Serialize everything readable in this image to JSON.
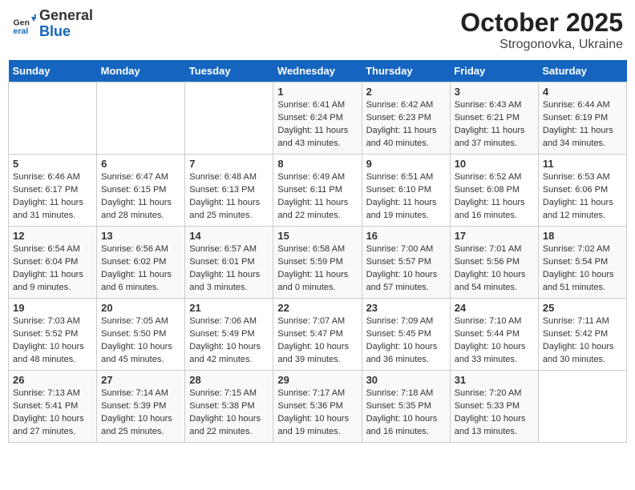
{
  "header": {
    "logo_general": "General",
    "logo_blue": "Blue",
    "month_title": "October 2025",
    "subtitle": "Strogonovka, Ukraine"
  },
  "weekdays": [
    "Sunday",
    "Monday",
    "Tuesday",
    "Wednesday",
    "Thursday",
    "Friday",
    "Saturday"
  ],
  "weeks": [
    [
      {
        "day": "",
        "info": ""
      },
      {
        "day": "",
        "info": ""
      },
      {
        "day": "",
        "info": ""
      },
      {
        "day": "1",
        "info": "Sunrise: 6:41 AM\nSunset: 6:24 PM\nDaylight: 11 hours\nand 43 minutes."
      },
      {
        "day": "2",
        "info": "Sunrise: 6:42 AM\nSunset: 6:23 PM\nDaylight: 11 hours\nand 40 minutes."
      },
      {
        "day": "3",
        "info": "Sunrise: 6:43 AM\nSunset: 6:21 PM\nDaylight: 11 hours\nand 37 minutes."
      },
      {
        "day": "4",
        "info": "Sunrise: 6:44 AM\nSunset: 6:19 PM\nDaylight: 11 hours\nand 34 minutes."
      }
    ],
    [
      {
        "day": "5",
        "info": "Sunrise: 6:46 AM\nSunset: 6:17 PM\nDaylight: 11 hours\nand 31 minutes."
      },
      {
        "day": "6",
        "info": "Sunrise: 6:47 AM\nSunset: 6:15 PM\nDaylight: 11 hours\nand 28 minutes."
      },
      {
        "day": "7",
        "info": "Sunrise: 6:48 AM\nSunset: 6:13 PM\nDaylight: 11 hours\nand 25 minutes."
      },
      {
        "day": "8",
        "info": "Sunrise: 6:49 AM\nSunset: 6:11 PM\nDaylight: 11 hours\nand 22 minutes."
      },
      {
        "day": "9",
        "info": "Sunrise: 6:51 AM\nSunset: 6:10 PM\nDaylight: 11 hours\nand 19 minutes."
      },
      {
        "day": "10",
        "info": "Sunrise: 6:52 AM\nSunset: 6:08 PM\nDaylight: 11 hours\nand 16 minutes."
      },
      {
        "day": "11",
        "info": "Sunrise: 6:53 AM\nSunset: 6:06 PM\nDaylight: 11 hours\nand 12 minutes."
      }
    ],
    [
      {
        "day": "12",
        "info": "Sunrise: 6:54 AM\nSunset: 6:04 PM\nDaylight: 11 hours\nand 9 minutes."
      },
      {
        "day": "13",
        "info": "Sunrise: 6:56 AM\nSunset: 6:02 PM\nDaylight: 11 hours\nand 6 minutes."
      },
      {
        "day": "14",
        "info": "Sunrise: 6:57 AM\nSunset: 6:01 PM\nDaylight: 11 hours\nand 3 minutes."
      },
      {
        "day": "15",
        "info": "Sunrise: 6:58 AM\nSunset: 5:59 PM\nDaylight: 11 hours\nand 0 minutes."
      },
      {
        "day": "16",
        "info": "Sunrise: 7:00 AM\nSunset: 5:57 PM\nDaylight: 10 hours\nand 57 minutes."
      },
      {
        "day": "17",
        "info": "Sunrise: 7:01 AM\nSunset: 5:56 PM\nDaylight: 10 hours\nand 54 minutes."
      },
      {
        "day": "18",
        "info": "Sunrise: 7:02 AM\nSunset: 5:54 PM\nDaylight: 10 hours\nand 51 minutes."
      }
    ],
    [
      {
        "day": "19",
        "info": "Sunrise: 7:03 AM\nSunset: 5:52 PM\nDaylight: 10 hours\nand 48 minutes."
      },
      {
        "day": "20",
        "info": "Sunrise: 7:05 AM\nSunset: 5:50 PM\nDaylight: 10 hours\nand 45 minutes."
      },
      {
        "day": "21",
        "info": "Sunrise: 7:06 AM\nSunset: 5:49 PM\nDaylight: 10 hours\nand 42 minutes."
      },
      {
        "day": "22",
        "info": "Sunrise: 7:07 AM\nSunset: 5:47 PM\nDaylight: 10 hours\nand 39 minutes."
      },
      {
        "day": "23",
        "info": "Sunrise: 7:09 AM\nSunset: 5:45 PM\nDaylight: 10 hours\nand 36 minutes."
      },
      {
        "day": "24",
        "info": "Sunrise: 7:10 AM\nSunset: 5:44 PM\nDaylight: 10 hours\nand 33 minutes."
      },
      {
        "day": "25",
        "info": "Sunrise: 7:11 AM\nSunset: 5:42 PM\nDaylight: 10 hours\nand 30 minutes."
      }
    ],
    [
      {
        "day": "26",
        "info": "Sunrise: 7:13 AM\nSunset: 5:41 PM\nDaylight: 10 hours\nand 27 minutes."
      },
      {
        "day": "27",
        "info": "Sunrise: 7:14 AM\nSunset: 5:39 PM\nDaylight: 10 hours\nand 25 minutes."
      },
      {
        "day": "28",
        "info": "Sunrise: 7:15 AM\nSunset: 5:38 PM\nDaylight: 10 hours\nand 22 minutes."
      },
      {
        "day": "29",
        "info": "Sunrise: 7:17 AM\nSunset: 5:36 PM\nDaylight: 10 hours\nand 19 minutes."
      },
      {
        "day": "30",
        "info": "Sunrise: 7:18 AM\nSunset: 5:35 PM\nDaylight: 10 hours\nand 16 minutes."
      },
      {
        "day": "31",
        "info": "Sunrise: 7:20 AM\nSunset: 5:33 PM\nDaylight: 10 hours\nand 13 minutes."
      },
      {
        "day": "",
        "info": ""
      }
    ]
  ]
}
